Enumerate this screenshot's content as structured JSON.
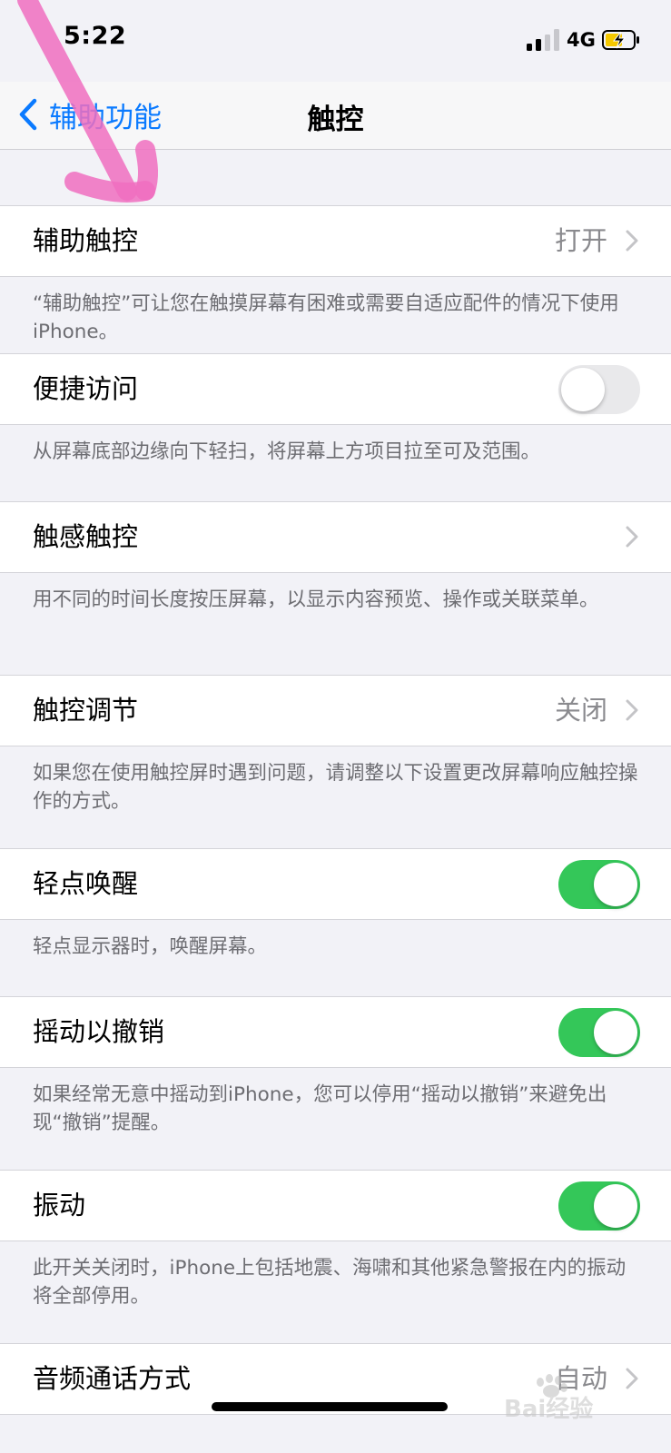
{
  "status_bar": {
    "time": "5:22",
    "network": "4G"
  },
  "nav": {
    "back_label": "辅助功能",
    "title": "触控"
  },
  "settings": [
    {
      "label": "辅助触控",
      "value": "打开",
      "control": "chevron",
      "footer": "“辅助触控”可让您在触摸屏幕有困难或需要自适应配件的情况下使用iPhone。"
    },
    {
      "label": "便捷访问",
      "control": "toggle",
      "on": false,
      "footer": "从屏幕底部边缘向下轻扫，将屏幕上方项目拉至可及范围。"
    },
    {
      "label": "触感触控",
      "control": "chevron",
      "footer": "用不同的时间长度按压屏幕，以显示内容预览、操作或关联菜单。"
    },
    {
      "label": "触控调节",
      "value": "关闭",
      "control": "chevron",
      "footer": "如果您在使用触控屏时遇到问题，请调整以下设置更改屏幕响应触控操作的方式。"
    },
    {
      "label": "轻点唤醒",
      "control": "toggle",
      "on": true,
      "footer": "轻点显示器时，唤醒屏幕。"
    },
    {
      "label": "摇动以撤销",
      "control": "toggle",
      "on": true,
      "footer": "如果经常无意中摇动到iPhone，您可以停用“摇动以撤销”来避免出现“撤销”提醒。"
    },
    {
      "label": "振动",
      "control": "toggle",
      "on": true,
      "footer": "此开关关闭时，iPhone上包括地震、海啸和其他紧急警报在内的振动将全部停用。"
    },
    {
      "label": "音频通话方式",
      "value": "自动",
      "control": "chevron"
    }
  ],
  "colors": {
    "accent": "#0a7aff",
    "toggle_on": "#34c759",
    "toggle_off": "#e9e9eb",
    "annotation": "#f06ec0"
  },
  "icons": {
    "back": "chevron-left-icon",
    "disclosure": "chevron-right-icon",
    "signal": "cellular-signal-icon",
    "battery": "battery-charging-icon"
  },
  "watermark": {
    "text": "Bai经验"
  }
}
